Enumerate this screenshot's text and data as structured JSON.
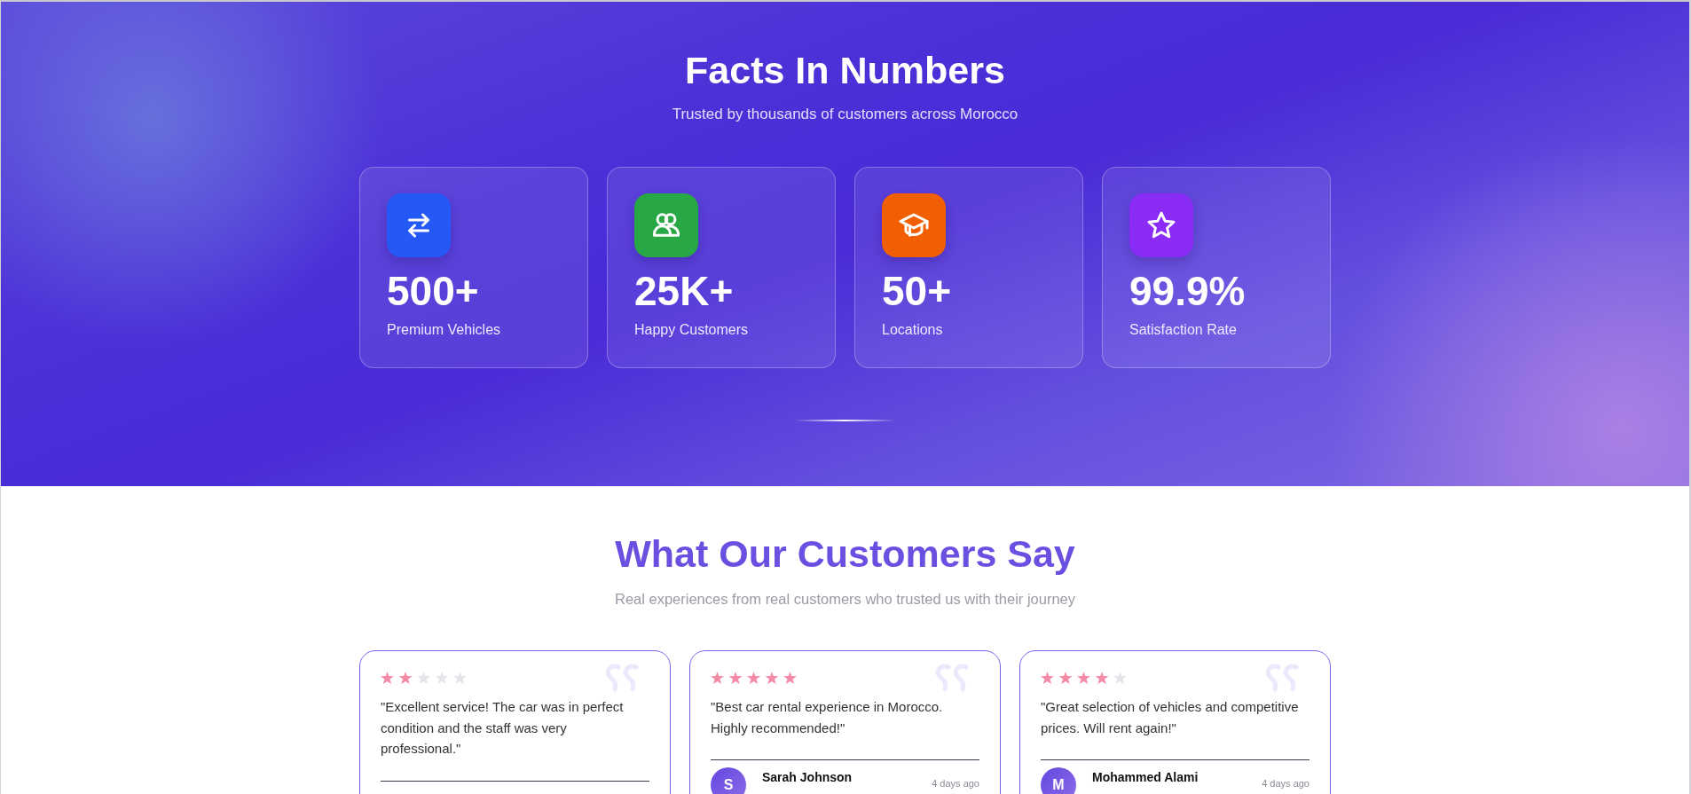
{
  "stats_section": {
    "title": "Facts In Numbers",
    "subtitle": "Trusted by thousands of customers across Morocco",
    "stats": [
      {
        "kind": "swap",
        "color": "#2459f6",
        "value": "500+",
        "label": "Premium Vehicles"
      },
      {
        "kind": "people",
        "color": "#28a745",
        "value": "25K+",
        "label": "Happy Customers"
      },
      {
        "kind": "cap",
        "color": "#f25f02",
        "value": "50+",
        "label": "Locations"
      },
      {
        "kind": "star",
        "color": "#8a2cf6",
        "value": "99.9%",
        "label": "Satisfaction Rate"
      }
    ]
  },
  "testimonials_section": {
    "title": "What Our Customers Say",
    "subtitle": "Real experiences from real customers who trusted us with their journey",
    "testimonials": [
      {
        "stars": 2,
        "quote": "\"Excellent service! The car was in perfect condition and the staff was very professional.\""
      },
      {
        "stars": 5,
        "quote": "\"Best car rental experience in Morocco. Highly recommended!\"",
        "author": {
          "initial": "S",
          "name": "Sarah Johnson",
          "time": "4 days ago"
        }
      },
      {
        "stars": 4,
        "quote": "\"Great selection of vehicles and competitive prices. Will rent again!\"",
        "author": {
          "initial": "M",
          "name": "Mohammed Alami",
          "time": "4 days ago"
        }
      }
    ]
  }
}
